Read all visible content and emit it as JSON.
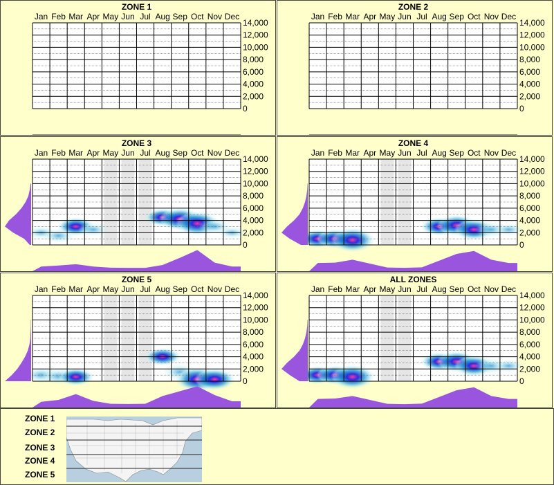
{
  "months": [
    "Jan",
    "Feb",
    "Mar",
    "Apr",
    "May",
    "Jun",
    "Jul",
    "Aug",
    "Sep",
    "Oct",
    "Nov",
    "Dec"
  ],
  "y_ticks": [
    "14,000",
    "12,000",
    "10,000",
    "8,000",
    "6,000",
    "4,000",
    "2,000",
    "0"
  ],
  "chart_data": [
    {
      "type": "heatmap",
      "title": "ZONE 1",
      "ylim": [
        0,
        14000
      ],
      "empty": true
    },
    {
      "type": "heatmap",
      "title": "ZONE 2",
      "ylim": [
        0,
        14000
      ],
      "empty": true
    },
    {
      "type": "heatmap",
      "title": "ZONE 3",
      "ylim": [
        0,
        14000
      ],
      "shaded_months": [
        "May",
        "Jun",
        "Jul"
      ],
      "hotspots": [
        {
          "month": "Jan",
          "elevation": 2000,
          "intensity": 0.25
        },
        {
          "month": "Feb",
          "elevation": 1500,
          "intensity": 0.35
        },
        {
          "month": "Mar",
          "elevation": 3000,
          "intensity": 0.6
        },
        {
          "month": "Apr",
          "elevation": 2500,
          "intensity": 0.3
        },
        {
          "month": "Aug",
          "elevation": 4500,
          "intensity": 0.55
        },
        {
          "month": "Sep",
          "elevation": 4200,
          "intensity": 0.85
        },
        {
          "month": "Oct",
          "elevation": 3500,
          "intensity": 0.95
        },
        {
          "month": "Nov",
          "elevation": 3000,
          "intensity": 0.4
        },
        {
          "month": "Dec",
          "elevation": 2000,
          "intensity": 0.2
        }
      ],
      "month_profile": [
        0.1,
        0.15,
        0.22,
        0.1,
        0.04,
        0.03,
        0.03,
        0.18,
        0.55,
        0.95,
        0.3,
        0.1
      ],
      "elevation_profile": [
        0.05,
        0.25,
        0.65,
        0.95,
        0.8,
        0.55,
        0.35,
        0.2,
        0.1,
        0.05,
        0.02
      ]
    },
    {
      "type": "heatmap",
      "title": "ZONE 4",
      "ylim": [
        0,
        14000
      ],
      "shaded_months": [
        "May",
        "Jun"
      ],
      "hotspots": [
        {
          "month": "Jan",
          "elevation": 1000,
          "intensity": 0.6
        },
        {
          "month": "Feb",
          "elevation": 1000,
          "intensity": 0.65
        },
        {
          "month": "Mar",
          "elevation": 800,
          "intensity": 0.95
        },
        {
          "month": "Aug",
          "elevation": 3000,
          "intensity": 0.6
        },
        {
          "month": "Sep",
          "elevation": 3200,
          "intensity": 0.75
        },
        {
          "month": "Oct",
          "elevation": 2500,
          "intensity": 0.75
        },
        {
          "month": "Nov",
          "elevation": 2500,
          "intensity": 0.4
        },
        {
          "month": "Dec",
          "elevation": 2500,
          "intensity": 0.25
        }
      ],
      "month_profile": [
        0.28,
        0.3,
        0.45,
        0.25,
        0.05,
        0.03,
        0.06,
        0.4,
        0.75,
        0.9,
        0.45,
        0.28
      ],
      "elevation_profile": [
        0.25,
        0.65,
        0.95,
        0.75,
        0.5,
        0.3,
        0.18,
        0.1,
        0.05,
        0.02,
        0.01
      ]
    },
    {
      "type": "heatmap",
      "title": "ZONE 5",
      "ylim": [
        0,
        14000
      ],
      "shaded_months": [
        "May",
        "Jun",
        "Jul"
      ],
      "hotspots": [
        {
          "month": "Jan",
          "elevation": 1000,
          "intensity": 0.45
        },
        {
          "month": "Feb",
          "elevation": 800,
          "intensity": 0.5
        },
        {
          "month": "Mar",
          "elevation": 700,
          "intensity": 0.55
        },
        {
          "month": "Aug",
          "elevation": 4000,
          "intensity": 0.55
        },
        {
          "month": "Sep",
          "elevation": 1500,
          "intensity": 0.45
        },
        {
          "month": "Oct",
          "elevation": 300,
          "intensity": 0.95
        },
        {
          "month": "Nov",
          "elevation": 300,
          "intensity": 0.8
        }
      ],
      "month_profile": [
        0.15,
        0.25,
        0.55,
        0.2,
        0.05,
        0.04,
        0.05,
        0.45,
        0.7,
        0.95,
        0.5,
        0.18
      ],
      "elevation_profile": [
        0.95,
        0.7,
        0.5,
        0.35,
        0.22,
        0.12,
        0.06,
        0.03,
        0.02,
        0.01,
        0.01
      ]
    },
    {
      "type": "heatmap",
      "title": "ALL ZONES",
      "ylim": [
        0,
        14000
      ],
      "shaded_months": [
        "May",
        "Jun"
      ],
      "hotspots": [
        {
          "month": "Jan",
          "elevation": 1000,
          "intensity": 0.6
        },
        {
          "month": "Feb",
          "elevation": 1000,
          "intensity": 0.65
        },
        {
          "month": "Mar",
          "elevation": 700,
          "intensity": 0.95
        },
        {
          "month": "Aug",
          "elevation": 3200,
          "intensity": 0.6
        },
        {
          "month": "Sep",
          "elevation": 3200,
          "intensity": 0.75
        },
        {
          "month": "Oct",
          "elevation": 2500,
          "intensity": 0.75
        },
        {
          "month": "Nov",
          "elevation": 2500,
          "intensity": 0.4
        },
        {
          "month": "Dec",
          "elevation": 2500,
          "intensity": 0.25
        }
      ],
      "month_profile": [
        0.3,
        0.32,
        0.45,
        0.25,
        0.05,
        0.03,
        0.06,
        0.4,
        0.75,
        0.9,
        0.45,
        0.3
      ],
      "elevation_profile": [
        0.3,
        0.65,
        0.95,
        0.75,
        0.5,
        0.3,
        0.18,
        0.1,
        0.05,
        0.02,
        0.01
      ]
    }
  ],
  "legend": {
    "zones": [
      "ZONE 1",
      "ZONE 2",
      "ZONE 3",
      "ZONE 4",
      "ZONE 5"
    ]
  },
  "colors": {
    "background": "#ffffcc",
    "profile": "#9955dd",
    "shade": "#e6e6e6",
    "heat_low": "#bfeff4",
    "heat_mid": "#1a8fd0",
    "heat_hi": "#2222dd",
    "heat_peak": "#ff33aa"
  }
}
